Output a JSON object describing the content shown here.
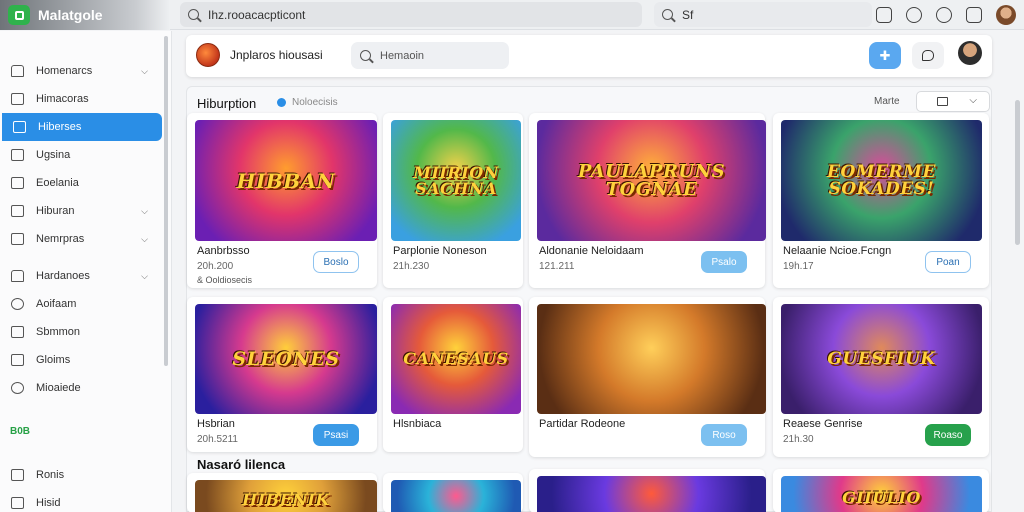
{
  "brand": {
    "name": "Malatgole"
  },
  "address_bar": {
    "url": "Ihz.rooacacpticont"
  },
  "top_search": {
    "text": "Sf"
  },
  "sidebar": {
    "items": [
      {
        "label": "Homenarcs",
        "icon": "home-icon",
        "chevron": true,
        "active": false
      },
      {
        "label": "Himacoras",
        "icon": "calendar-icon",
        "chevron": false,
        "active": false
      },
      {
        "label": "Hiberses",
        "icon": "folder-icon",
        "chevron": false,
        "active": true
      },
      {
        "label": "Ugsina",
        "icon": "document-icon",
        "chevron": false,
        "active": false
      },
      {
        "label": "Eoelania",
        "icon": "list-icon",
        "chevron": false,
        "active": false
      },
      {
        "label": "Hiburan",
        "icon": "box-icon",
        "chevron": true,
        "active": false
      },
      {
        "label": "Nemrpras",
        "icon": "grid-icon",
        "chevron": true,
        "active": false
      },
      {
        "label": "Hardanoes",
        "icon": "bell-icon",
        "chevron": true,
        "active": false
      },
      {
        "label": "Aoifaam",
        "icon": "user-icon",
        "chevron": false,
        "active": false
      },
      {
        "label": "Sbmmon",
        "icon": "settings-icon",
        "chevron": false,
        "active": false
      },
      {
        "label": "Gloims",
        "icon": "tag-icon",
        "chevron": false,
        "active": false
      },
      {
        "label": "Mioaiede",
        "icon": "help-icon",
        "chevron": false,
        "active": false
      },
      {
        "label": "Ronis",
        "icon": "star-icon",
        "chevron": false,
        "active": false
      },
      {
        "label": "Hisid",
        "icon": "share-icon",
        "chevron": false,
        "active": false
      }
    ],
    "section_label": "B0B"
  },
  "header": {
    "title": "Jnplaros hiousasi",
    "search_placeholder": "Hemaoin"
  },
  "section": {
    "title": "Hiburption",
    "subtitle": "Noloecisis",
    "sort_label": "Marte"
  },
  "section2": {
    "title": "Nasaró lilenca"
  },
  "cards": [
    {
      "thumb_text": "HIBBAN",
      "name": "Aanbrbsso",
      "meta": "20h.200",
      "sub": "& Ooldiosecis",
      "button": "Boslo",
      "button_style": "outline",
      "colors": [
        "#6b1fb3",
        "#e2356a",
        "#ff9d2e"
      ]
    },
    {
      "thumb_text": "MIIRION SACHNA",
      "name": "Parplonie Noneson",
      "meta": "21h.230",
      "sub": "",
      "button": "",
      "button_style": "none",
      "colors": [
        "#3aa0e0",
        "#52b84a",
        "#f2d14a"
      ]
    },
    {
      "thumb_text": "PAULAPRUNS TOGNAE",
      "name": "Aldonanie Neloidaam",
      "meta": "121.211",
      "sub": "",
      "button": "Psalo",
      "button_style": "lightblue",
      "colors": [
        "#5b2a9e",
        "#e0406b",
        "#ffb03a"
      ]
    },
    {
      "thumb_text": "EOMERME SOKADES!",
      "name": "Nelaanie Ncioe.Fcngn",
      "meta": "19h.17",
      "sub": "",
      "button": "Poan",
      "button_style": "outline",
      "colors": [
        "#1f2a6b",
        "#3aa36b",
        "#d94b9a"
      ]
    },
    {
      "thumb_text": "SLEONES",
      "name": "Hsbrian",
      "meta": "20h.5211",
      "sub": "",
      "button": "Psasi",
      "button_style": "blue",
      "colors": [
        "#2a1f9e",
        "#d63a8e",
        "#ffcf3a"
      ]
    },
    {
      "thumb_text": "CANESAUS",
      "name": "Hlsnbiaca",
      "meta": "",
      "sub": "",
      "button": "",
      "button_style": "none",
      "colors": [
        "#8a2ab3",
        "#e55a3a",
        "#ffd23a"
      ]
    },
    {
      "thumb_text": "",
      "name": "Partidar Rodeone",
      "meta": "",
      "sub": "",
      "button": "Roso",
      "button_style": "lightblue",
      "colors": [
        "#5a2e14",
        "#d47a2a",
        "#ffcf5a"
      ]
    },
    {
      "thumb_text": "GUESFIUK",
      "name": "Reaese Genrise",
      "meta": "21h.30",
      "sub": "",
      "button": "Roaso",
      "button_style": "green",
      "colors": [
        "#3a1f6b",
        "#8a4ad9",
        "#e08a5a"
      ]
    },
    {
      "thumb_text": "HIBENIK",
      "name": "",
      "meta": "",
      "sub": "",
      "button": "",
      "button_style": "none",
      "colors": [
        "#7a4a1f",
        "#e0a03a",
        "#ffd23a"
      ]
    },
    {
      "thumb_text": "",
      "name": "",
      "meta": "",
      "sub": "",
      "button": "",
      "button_style": "none",
      "colors": [
        "#1f5ab3",
        "#2ab3d9",
        "#ff5a8e"
      ]
    },
    {
      "thumb_text": "",
      "name": "",
      "meta": "",
      "sub": "",
      "button": "",
      "button_style": "none",
      "colors": [
        "#2a1f8a",
        "#6a3ae0",
        "#ff5a3a"
      ]
    },
    {
      "thumb_text": "GIIULIO",
      "name": "",
      "meta": "",
      "sub": "",
      "button": "",
      "button_style": "none",
      "colors": [
        "#3a8ae0",
        "#e03a8a",
        "#ffd23a"
      ]
    }
  ]
}
